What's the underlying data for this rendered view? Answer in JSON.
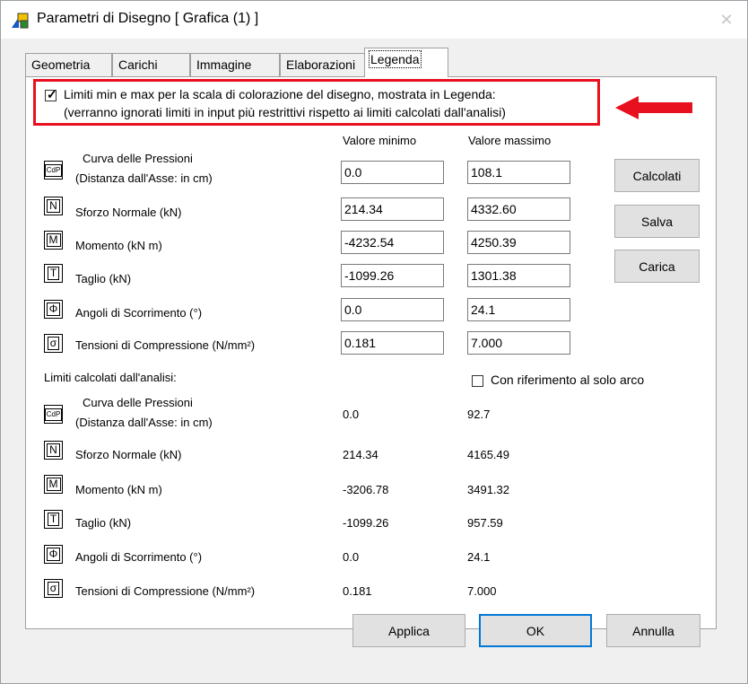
{
  "window": {
    "title": "Parametri di Disegno [ Grafica (1) ]",
    "close_glyph": "✕"
  },
  "tabs": [
    {
      "label": "Geometria",
      "active": false
    },
    {
      "label": "Carichi",
      "active": false
    },
    {
      "label": "Immagine",
      "active": false
    },
    {
      "label": "Elaborazioni",
      "active": false
    },
    {
      "label": "Legenda",
      "active": true
    }
  ],
  "legend_limits": {
    "checkbox_checked": true,
    "line1": "Limiti min e max per la scala di colorazione del disegno, mostrata in Legenda:",
    "line2": "(verranno ignorati limiti in input più restrittivi rispetto ai limiti calcolati dall'analisi)"
  },
  "columns": {
    "min": "Valore minimo",
    "max": "Valore massimo"
  },
  "input_rows": [
    {
      "icon": "CdP",
      "label": "Curva delle Pressioni",
      "label2": "(Distanza dall'Asse: in cm)",
      "min": "0.0",
      "max": "108.1"
    },
    {
      "icon": "N",
      "label": "Sforzo Normale (kN)",
      "min": "214.34",
      "max": "4332.60"
    },
    {
      "icon": "M",
      "label": "Momento (kN m)",
      "min": "-4232.54",
      "max": "4250.39"
    },
    {
      "icon": "T",
      "label": "Taglio (kN)",
      "min": "-1099.26",
      "max": "1301.38"
    },
    {
      "icon": "Φ",
      "label": "Angoli di Scorrimento (°)",
      "min": "0.0",
      "max": "24.1"
    },
    {
      "icon": "σ",
      "label": "Tensioni di Compressione (N/mm²)",
      "min": "0.181",
      "max": "7.000"
    }
  ],
  "side_buttons": {
    "calcolati": "Calcolati",
    "salva": "Salva",
    "carica": "Carica"
  },
  "computed": {
    "heading": "Limiti calcolati dall'analisi:",
    "arc_only_label": "Con riferimento al solo arco",
    "arc_only_checked": false,
    "rows": [
      {
        "icon": "CdP",
        "label": "Curva delle Pressioni",
        "label2": "(Distanza dall'Asse: in cm)",
        "min": "0.0",
        "max": "92.7"
      },
      {
        "icon": "N",
        "label": "Sforzo Normale (kN)",
        "min": "214.34",
        "max": "4165.49"
      },
      {
        "icon": "M",
        "label": "Momento (kN m)",
        "min": "-3206.78",
        "max": "3491.32"
      },
      {
        "icon": "T",
        "label": "Taglio (kN)",
        "min": "-1099.26",
        "max": "957.59"
      },
      {
        "icon": "Φ",
        "label": "Angoli di Scorrimento (°)",
        "min": "0.0",
        "max": "24.1"
      },
      {
        "icon": "σ",
        "label": "Tensioni di Compressione (N/mm²)",
        "min": "0.181",
        "max": "7.000"
      }
    ]
  },
  "footer_buttons": {
    "applica": "Applica",
    "ok": "OK",
    "annulla": "Annulla"
  },
  "colors": {
    "highlight": "#e8101e",
    "focus": "#0078d7"
  }
}
